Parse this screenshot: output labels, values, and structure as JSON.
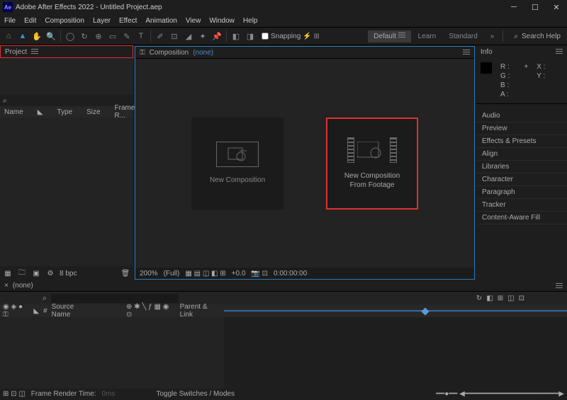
{
  "titlebar": {
    "app_icon": "Ae",
    "title": "Adobe After Effects 2022 - Untitled Project.aep"
  },
  "menu": [
    "File",
    "Edit",
    "Composition",
    "Layer",
    "Effect",
    "Animation",
    "View",
    "Window",
    "Help"
  ],
  "toolbar": {
    "snapping_label": "Snapping",
    "workspaces": {
      "default": "Default",
      "learn": "Learn",
      "standard": "Standard"
    },
    "search_placeholder": "Search Help"
  },
  "project_panel": {
    "tab": "Project",
    "columns": {
      "name": "Name",
      "type": "Type",
      "size": "Size",
      "framer": "Frame R..."
    },
    "footer_bpc": "8 bpc"
  },
  "composition_panel": {
    "tab_label": "Composition",
    "tab_none": "(none)",
    "card1": "New Composition",
    "card2_line1": "New Composition",
    "card2_line2": "From Footage",
    "footer": {
      "zoom": "200%",
      "res": "(Full)",
      "time": "+0.0",
      "tc": "0:00:00:00"
    }
  },
  "info_panel": {
    "title": "Info",
    "rgba": [
      "R :",
      "G :",
      "B :",
      "A :"
    ],
    "xy": [
      "X :",
      "Y :"
    ]
  },
  "accordion": [
    "Audio",
    "Preview",
    "Effects & Presets",
    "Align",
    "Libraries",
    "Character",
    "Paragraph",
    "Tracker",
    "Content-Aware Fill"
  ],
  "timeline": {
    "tab_none": "(none)",
    "header": {
      "source_name": "Source Name",
      "parent_link": "Parent & Link"
    },
    "footer": {
      "render_time_label": "Frame Render Time:",
      "render_time_val": "0ms",
      "toggle": "Toggle Switches / Modes"
    }
  }
}
